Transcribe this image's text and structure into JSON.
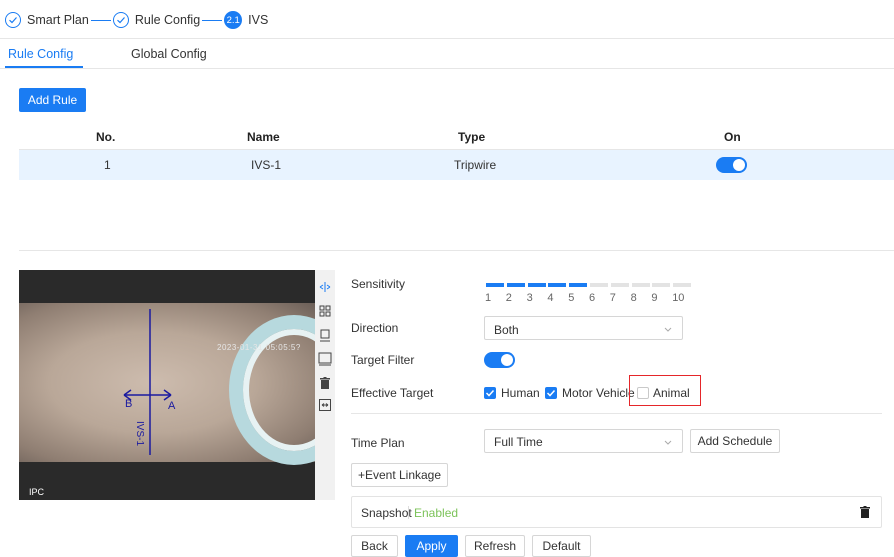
{
  "stepper": {
    "steps": [
      {
        "label": "Smart Plan",
        "state": "done"
      },
      {
        "label": "Rule Config",
        "state": "done"
      },
      {
        "label": "IVS",
        "number": "2.1",
        "state": "active"
      }
    ]
  },
  "tabs": [
    {
      "label": "Rule Config",
      "active": true
    },
    {
      "label": "Global Config",
      "active": false
    }
  ],
  "add_rule_label": "Add Rule",
  "table": {
    "headers": [
      "No.",
      "Name",
      "Type",
      "On"
    ],
    "rows": [
      {
        "no": "1",
        "name": "IVS-1",
        "type": "Tripwire",
        "on": true
      }
    ]
  },
  "video": {
    "timestamp": "2023-01-31 05:05:5?",
    "channel_label": "IPC",
    "rule_label": "IVS-1",
    "point_a": "A",
    "point_b": "B"
  },
  "video_tools": [
    "tripwire-draw-icon",
    "region-icon",
    "min-size-icon",
    "max-size-icon",
    "delete-icon",
    "pixel-counter-icon"
  ],
  "form": {
    "sensitivity": {
      "label": "Sensitivity",
      "value": 5,
      "max": 10,
      "ticks": [
        "1",
        "2",
        "3",
        "4",
        "5",
        "6",
        "7",
        "8",
        "9",
        "10"
      ]
    },
    "direction": {
      "label": "Direction",
      "value": "Both"
    },
    "target_filter": {
      "label": "Target Filter",
      "enabled": true
    },
    "effective_target": {
      "label": "Effective Target",
      "options": [
        {
          "label": "Human",
          "checked": true
        },
        {
          "label": "Motor Vehicle",
          "checked": true
        },
        {
          "label": "Animal",
          "checked": false
        }
      ]
    },
    "time_plan": {
      "label": "Time Plan",
      "value": "Full Time"
    },
    "add_schedule_label": "Add Schedule",
    "event_linkage_label": "+Event Linkage",
    "snapshot": {
      "label": "Snapshot",
      "status": "Enabled"
    }
  },
  "footer": {
    "back": "Back",
    "apply": "Apply",
    "refresh": "Refresh",
    "default": "Default"
  },
  "colors": {
    "accent": "#1a7cf3",
    "enabled_text": "#7cc35a",
    "highlight": "#e5262a"
  }
}
